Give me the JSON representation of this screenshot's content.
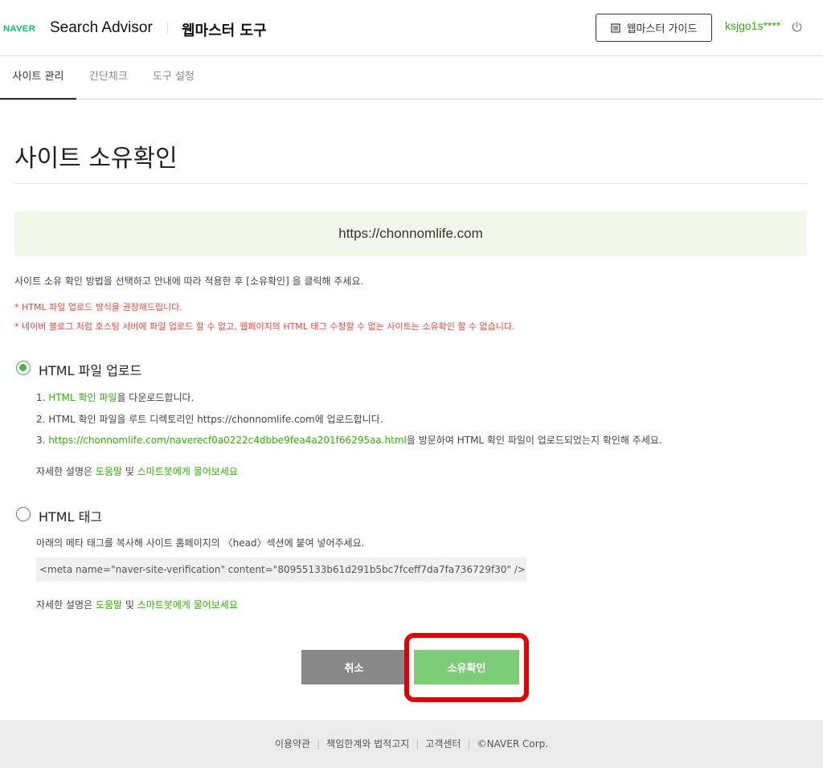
{
  "header": {
    "brand": "NAVER",
    "product": "Search Advisor",
    "subtitle": "웹마스터 도구",
    "guide_label": "웹마스터 가이드",
    "user": "ksjgo1s****"
  },
  "tabs": [
    {
      "label": "사이트 관리",
      "active": true
    },
    {
      "label": "간단체크",
      "active": false
    },
    {
      "label": "도구 설정",
      "active": false
    }
  ],
  "page": {
    "title": "사이트 소유확인",
    "site_url": "https://chonnomlife.com",
    "description": "사이트 소유 확인 방법을 선택하고 안내에 따라 적용한 후 [소유확인] 을 클릭해 주세요.",
    "notices": [
      "* HTML 파일 업로드 방식을 권장해드립니다.",
      "* 네이버 블로그 처럼 호스팅 서버에 파일 업로드 할 수 없고, 웹페이지의 HTML 태그 수정할 수 없는 사이트는 소유확인 할 수 없습니다."
    ]
  },
  "option_file": {
    "label": "HTML 파일 업로드",
    "selected": true,
    "step1_prefix": "1. ",
    "step1_link": "HTML 확인 파일",
    "step1_suffix": "을 다운로드합니다.",
    "step2": "2. HTML 확인 파일을 루트 디렉토리인 https://chonnomlife.com에 업로드합니다.",
    "step3_prefix": "3. ",
    "step3_link": "https://chonnomlife.com/naverecf0a0222c4dbbe9fea4a201f66295aa.html",
    "step3_suffix": "을 방문하여 HTML 확인 파일이 업로드되었는지 확인해 주세요.",
    "help_prefix": "자세한 설명은 ",
    "help_link1": "도움말",
    "help_mid": " 및 ",
    "help_link2": "스마트봇에게 물어보세요"
  },
  "option_tag": {
    "label": "HTML 태그",
    "selected": false,
    "description": "아래의 메타 태그를 복사해 사이트 홈페이지의 〈head〉섹션에 붙여 넣어주세요.",
    "meta_tag": "<meta name=\"naver-site-verification\" content=\"80955133b61d291b5bc7fceff7da7fa736729f30\" />",
    "help_prefix": "자세한 설명은 ",
    "help_link1": "도움말",
    "help_mid": " 및 ",
    "help_link2": "스마트봇에게 물어보세요"
  },
  "buttons": {
    "cancel": "취소",
    "confirm": "소유확인"
  },
  "footer": {
    "links": [
      "이용약관",
      "책임한계와 법적고지",
      "고객센터",
      "©NAVER Corp."
    ]
  },
  "colors": {
    "accent_green": "#2db400",
    "confirm_button": "#7ccc78",
    "cancel_button": "#888888",
    "notice_red": "#e8473a",
    "highlight_red": "#e40000",
    "site_box_bg": "#f1f8ea"
  }
}
